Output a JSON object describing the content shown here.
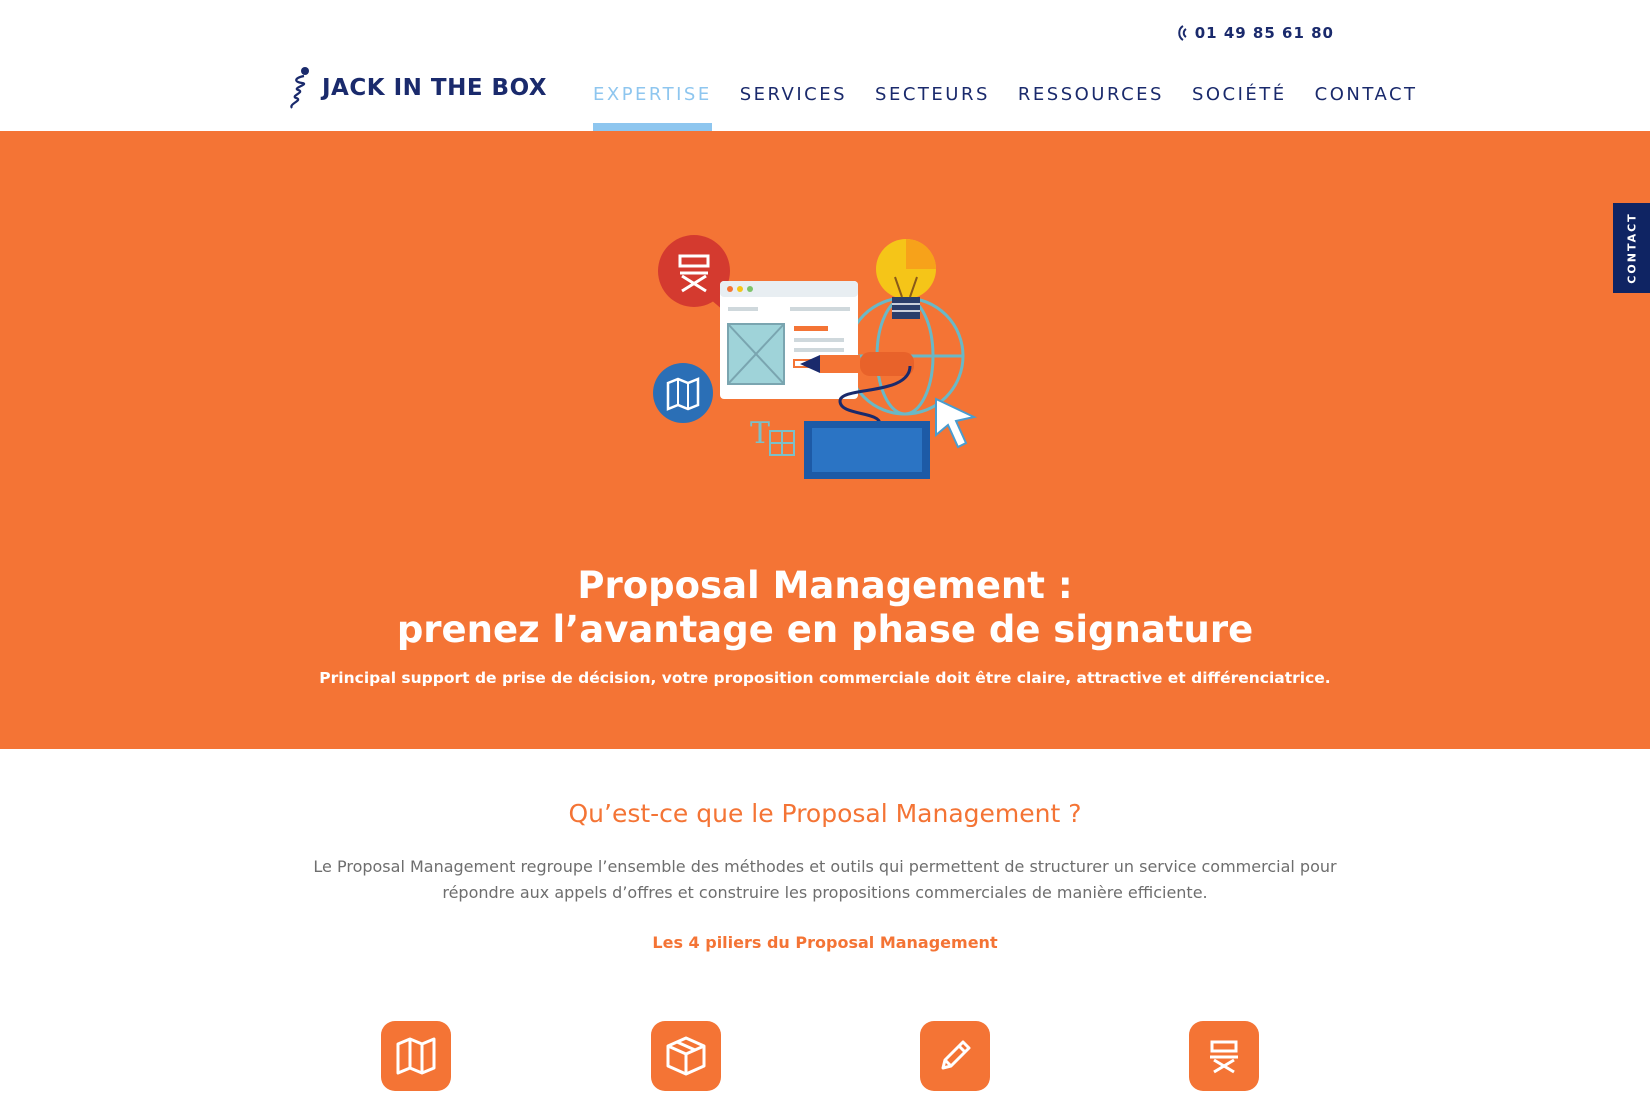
{
  "header": {
    "phone": "01 49 85 61 80",
    "logo_text": "JACK IN THE BOX",
    "nav": [
      {
        "label": "EXPERTISE"
      },
      {
        "label": "SERVICES"
      },
      {
        "label": "SECTEURS"
      },
      {
        "label": "RESSOURCES"
      },
      {
        "label": "SOCIÉTÉ"
      },
      {
        "label": "CONTACT"
      }
    ]
  },
  "hero": {
    "title_line1": "Proposal Management :",
    "title_line2": "prenez l’avantage en phase de signature",
    "subtitle": "Principal support de prise de décision, votre proposition commerciale doit être claire, attractive et différenciatrice."
  },
  "side_tab": {
    "label": "CONTACT"
  },
  "section": {
    "title": "Qu’est-ce que le Proposal Management ?",
    "text": "Le Proposal Management regroupe l’ensemble des méthodes et outils qui permettent de structurer un service commercial pour répondre aux appels d’offres et construire les propositions commerciales de manière efficiente.",
    "pillars_title": "Les 4 piliers du Proposal Management",
    "pillars": [
      {
        "icon": "map-icon"
      },
      {
        "icon": "box-icon"
      },
      {
        "icon": "pencil-icon"
      },
      {
        "icon": "director-chair-icon"
      }
    ]
  },
  "colors": {
    "brand_navy": "#1a2a6c",
    "accent_orange": "#f47435",
    "active_blue": "#8ec6ef"
  }
}
